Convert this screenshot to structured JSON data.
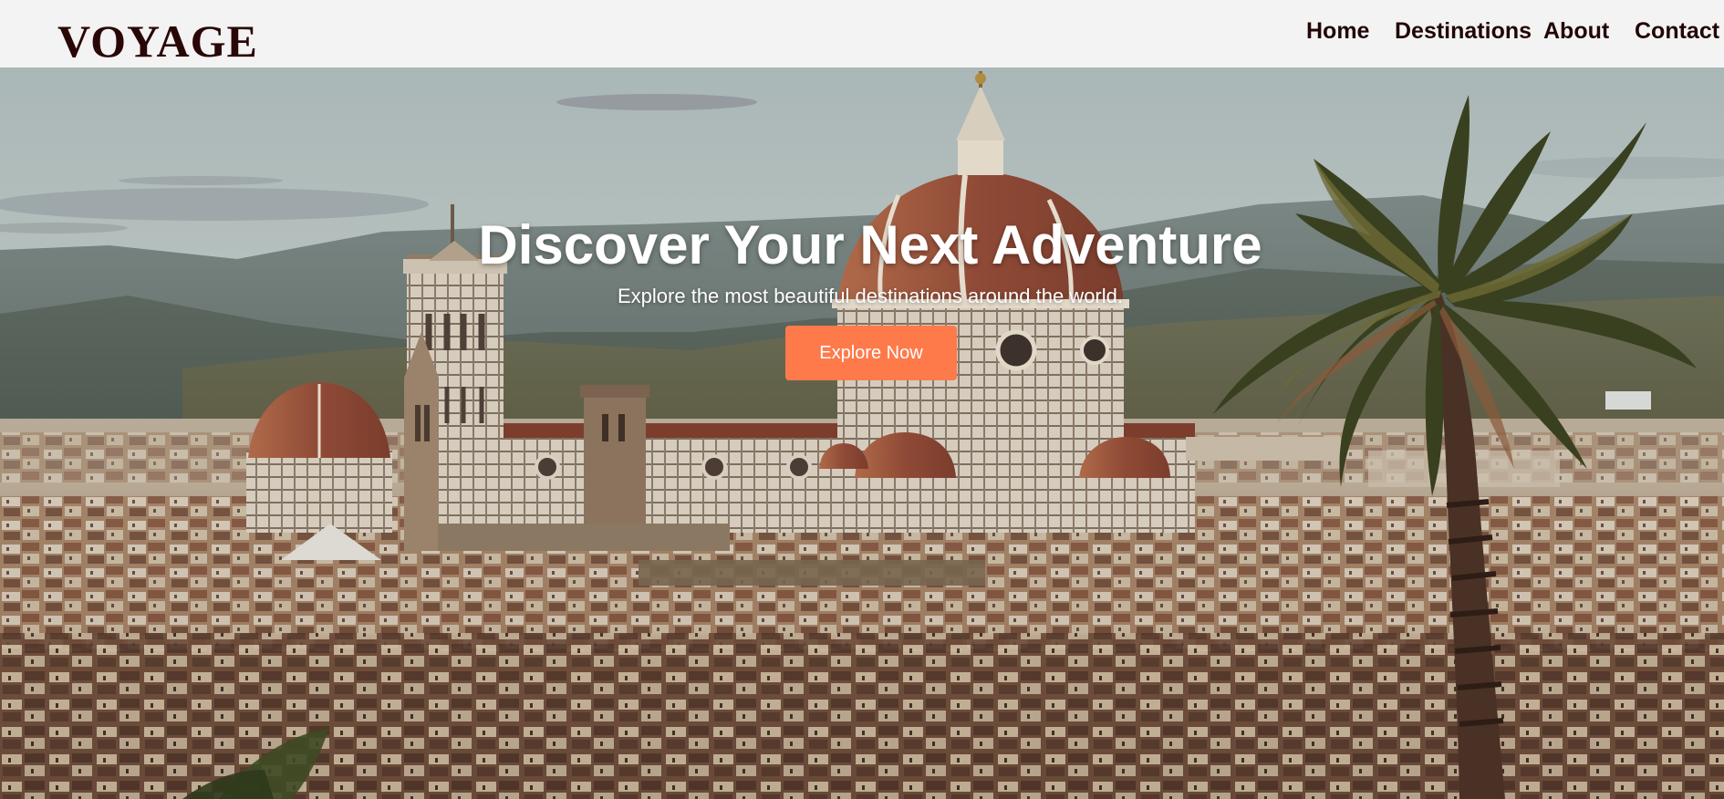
{
  "brand": {
    "logo_text": "VOYAGE"
  },
  "nav": {
    "items": [
      {
        "label": "Home"
      },
      {
        "label": "Destinations"
      },
      {
        "label": "About"
      },
      {
        "label": "Contact"
      }
    ]
  },
  "hero": {
    "title": "Discover Your Next Adventure",
    "subtitle": "Explore the most beautiful destinations around the world.",
    "cta_label": "Explore Now"
  },
  "colors": {
    "header_bg": "#f4f3f3",
    "logo": "#2a0707",
    "nav_text": "#220606",
    "cta_bg": "#ff7a4a",
    "hero_text": "#ffffff"
  }
}
